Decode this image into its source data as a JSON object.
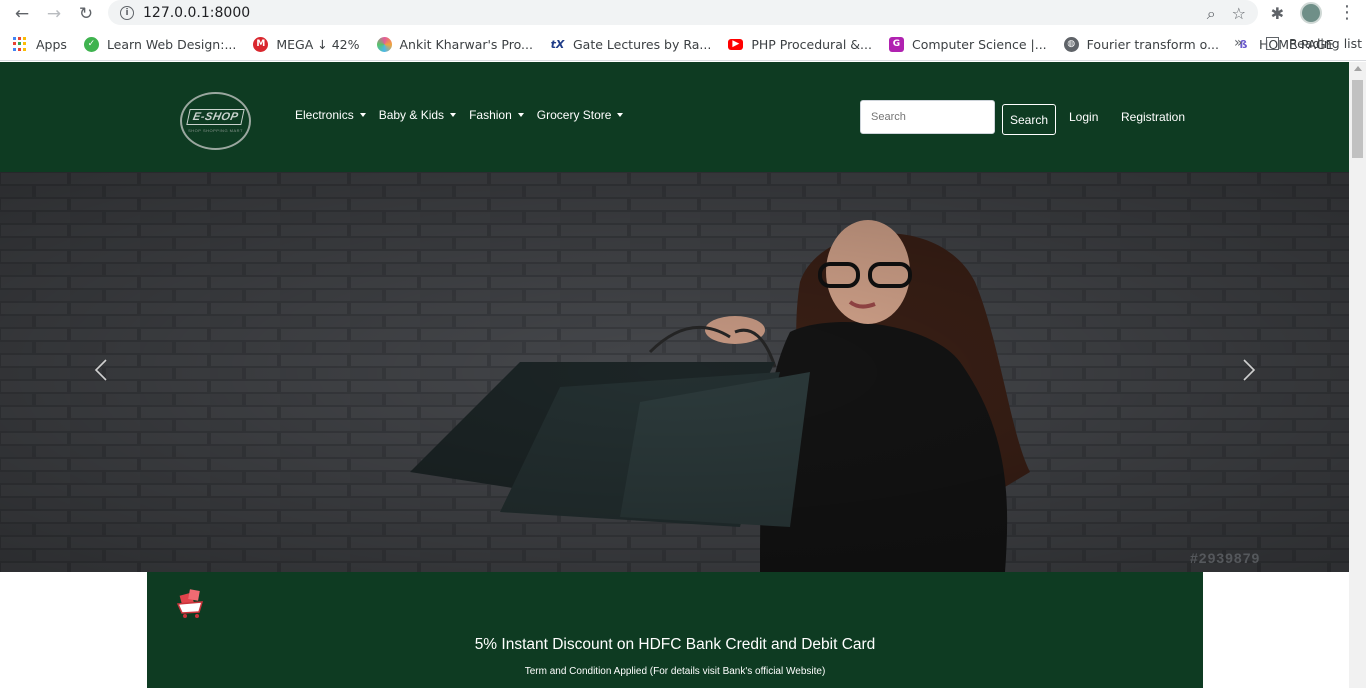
{
  "browser": {
    "url": "127.0.0.1:8000",
    "bookmarks": [
      {
        "label": "Apps",
        "icon": "apps-grid-icon"
      },
      {
        "label": "Learn Web Design:...",
        "icon": "webdesign-favicon",
        "color": "#3fb34f"
      },
      {
        "label": "MEGA ↓ 42%",
        "icon": "mega-favicon",
        "color": "#d9272e"
      },
      {
        "label": "Ankit Kharwar's Pro...",
        "icon": "pinwheel-favicon",
        "color": "#e35b9b"
      },
      {
        "label": "Gate Lectures by Ra...",
        "icon": "tx-favicon",
        "color": "#1f3c88"
      },
      {
        "label": "PHP Procedural &...",
        "icon": "youtube-favicon",
        "color": "#ff0000"
      },
      {
        "label": "Computer Science |...",
        "icon": "g-favicon",
        "color": "#b022b0"
      },
      {
        "label": "Fourier transform o...",
        "icon": "globe-favicon",
        "color": "#5f6368"
      },
      {
        "label": "HOME PAGE",
        "icon": "home-favicon",
        "color": "#6a5acd"
      }
    ],
    "reading_list": "Reading list",
    "more": "»"
  },
  "site": {
    "logo_text": "E-SHOP",
    "logo_sub": "SHOP SHOPPING MART",
    "menu": [
      {
        "label": "Electronics"
      },
      {
        "label": "Baby & Kids"
      },
      {
        "label": "Fashion"
      },
      {
        "label": "Grocery Store"
      }
    ],
    "search_placeholder": "Search",
    "search_button": "Search",
    "login": "Login",
    "registration": "Registration"
  },
  "hero": {
    "watermark": "#2939879"
  },
  "promo": {
    "title": "5% Instant Discount on HDFC Bank Credit and Debit Card",
    "subtitle": "Term and Condition Applied (For details visit Bank's official Website)"
  },
  "colors": {
    "brand_green": "#0e3b22",
    "hero_bg": "#3b3d41"
  }
}
